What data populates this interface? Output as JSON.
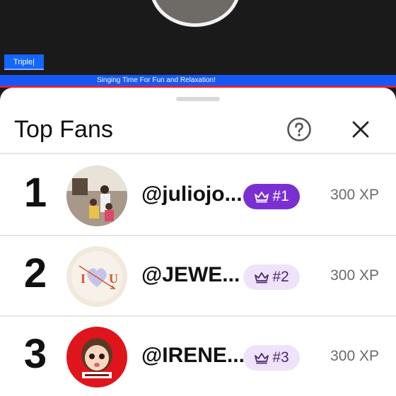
{
  "stream": {
    "channel_label": "Triple|",
    "ticker_text": "Singing Time For Fun and Relaxation!"
  },
  "sheet": {
    "title": "Top Fans",
    "help_icon": "help-circle-icon",
    "close_icon": "close-icon"
  },
  "fans": [
    {
      "rank": "1",
      "username": "@juliojo...",
      "badge": "#1",
      "xp": "300 XP",
      "badge_style": "highlight",
      "avatar": "photo-family-avatar"
    },
    {
      "rank": "2",
      "username": "@JEWE...",
      "badge": "#2",
      "xp": "300 XP",
      "badge_style": "soft",
      "avatar": "heart-i-love-u-avatar"
    },
    {
      "rank": "3",
      "username": "@IRENE...",
      "badge": "#3",
      "xp": "300 XP",
      "badge_style": "soft",
      "avatar": "cartoon-girl-avatar"
    }
  ],
  "colors": {
    "accent_purple": "#7b2fd3",
    "badge_soft_bg": "#efe3fb",
    "ticker_blue": "#1558f5"
  }
}
